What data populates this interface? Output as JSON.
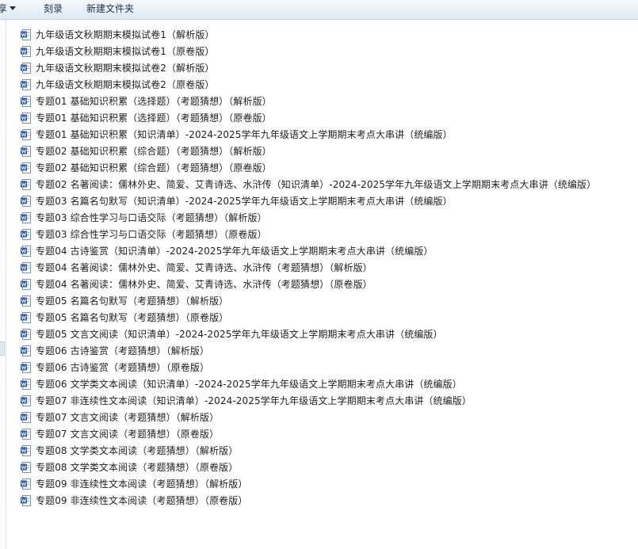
{
  "toolbar": {
    "share_label": "享",
    "burn_label": "刻录",
    "new_folder_label": "新建文件夹"
  },
  "icons": {
    "file_icon": "word-document-icon",
    "file_icon_color": "#2b5aa8"
  },
  "files": [
    {
      "name": "九年级语文秋期期末模拟试卷1（解析版）"
    },
    {
      "name": "九年级语文秋期期末模拟试卷1（原卷版）"
    },
    {
      "name": "九年级语文秋期期末模拟试卷2（解析版）"
    },
    {
      "name": "九年级语文秋期期末模拟试卷2（原卷版）"
    },
    {
      "name": "专题01 基础知识积累（选择题）（考题猜想）（解析版）"
    },
    {
      "name": "专题01 基础知识积累（选择题）（考题猜想）（原卷版）"
    },
    {
      "name": "专题01 基础知识积累（知识清单）-2024-2025学年九年级语文上学期期末考点大串讲（统编版）"
    },
    {
      "name": "专题02 基础知识积累（综合题）（考题猜想）（解析版）"
    },
    {
      "name": "专题02 基础知识积累（综合题）（考题猜想）（原卷版）"
    },
    {
      "name": "专题02 名著阅读：儒林外史、简爱、艾青诗选、水浒传（知识清单）-2024-2025学年九年级语文上学期期末考点大串讲（统编版）"
    },
    {
      "name": "专题03 名篇名句默写（知识清单）-2024-2025学年九年级语文上学期期末考点大串讲（统编版）"
    },
    {
      "name": "专题03 综合性学习与口语交际（考题猜想）（解析版）"
    },
    {
      "name": "专题03 综合性学习与口语交际（考题猜想）（原卷版）"
    },
    {
      "name": "专题04 古诗鉴赏（知识清单）-2024-2025学年九年级语文上学期期末考点大串讲（统编版）"
    },
    {
      "name": "专题04 名著阅读：儒林外史、简爱、艾青诗选、水浒传（考题猜想）（解析版）"
    },
    {
      "name": "专题04 名著阅读：儒林外史、简爱、艾青诗选、水浒传（考题猜想）（原卷版）"
    },
    {
      "name": "专题05 名篇名句默写（考题猜想）（解析版）"
    },
    {
      "name": "专题05 名篇名句默写（考题猜想）（原卷版）"
    },
    {
      "name": "专题05 文言文阅读（知识清单）-2024-2025学年九年级语文上学期期末考点大串讲（统编版）"
    },
    {
      "name": "专题06 古诗鉴赏（考题猜想）（解析版）"
    },
    {
      "name": "专题06 古诗鉴赏（考题猜想）（原卷版）"
    },
    {
      "name": "专题06 文学类文本阅读（知识清单）-2024-2025学年九年级语文上学期期末考点大串讲（统编版）"
    },
    {
      "name": "专题07 非连续性文本阅读（知识清单）-2024-2025学年九年级语文上学期期末考点大串讲（统编版）"
    },
    {
      "name": "专题07 文言文阅读（考题猜想）（解析版）"
    },
    {
      "name": "专题07 文言文阅读（考题猜想）（原卷版）"
    },
    {
      "name": "专题08 文学类文本阅读（考题猜想）（解析版）"
    },
    {
      "name": "专题08 文学类文本阅读（考题猜想）（原卷版）"
    },
    {
      "name": "专题09 非连续性文本阅读（考题猜想）（解析版）"
    },
    {
      "name": "专题09 非连续性文本阅读（考题猜想）（原卷版）"
    }
  ]
}
